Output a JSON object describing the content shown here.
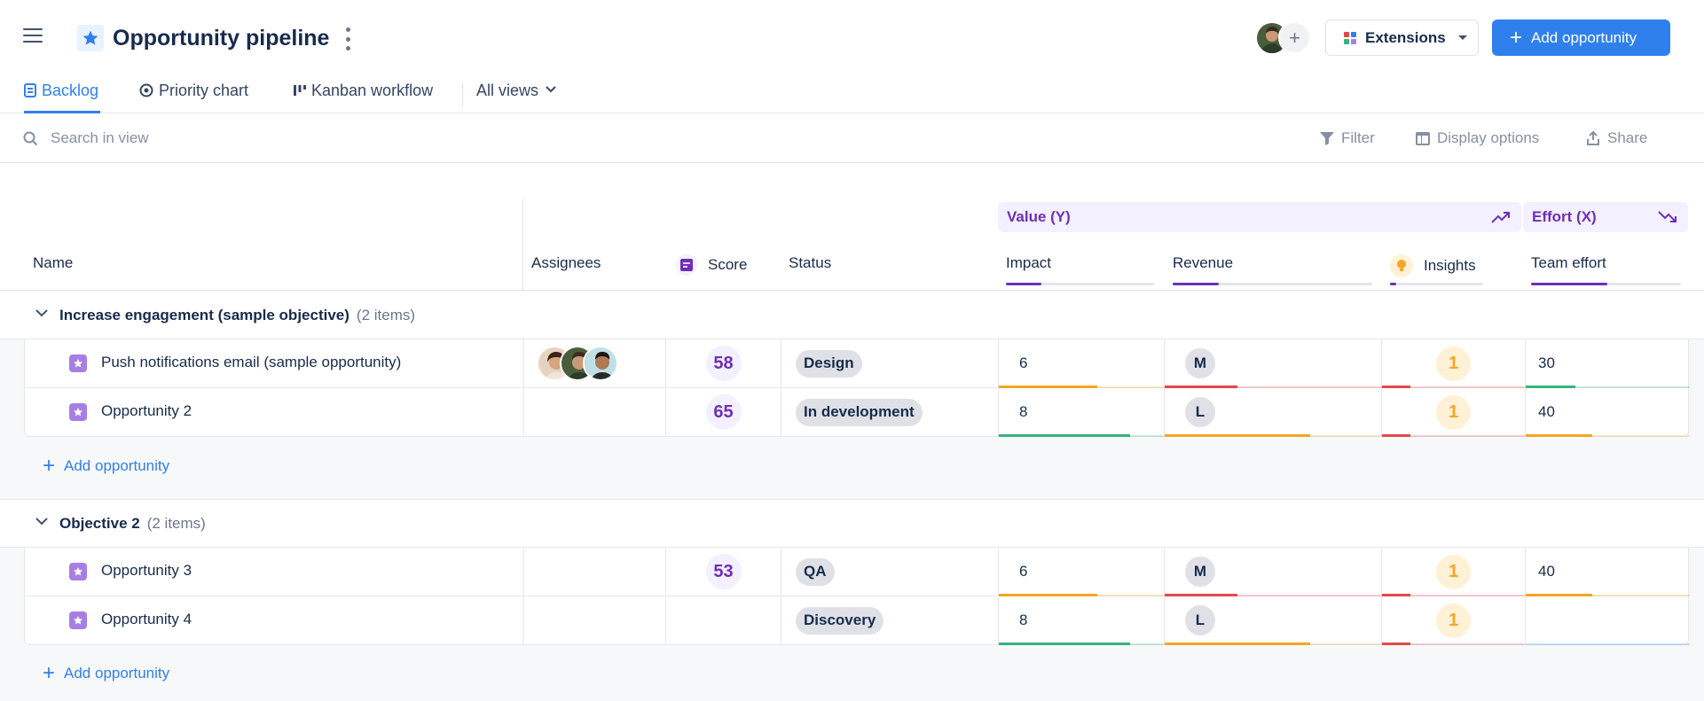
{
  "header": {
    "title": "Opportunity pipeline",
    "extensions_label": "Extensions",
    "add_button_label": "Add opportunity"
  },
  "tabs": [
    {
      "label": "Backlog",
      "active": true
    },
    {
      "label": "Priority chart"
    },
    {
      "label": "Kanban workflow"
    },
    {
      "label": "All views"
    }
  ],
  "toolbar": {
    "search_placeholder": "Search in view",
    "filter_label": "Filter",
    "display_label": "Display options",
    "share_label": "Share"
  },
  "column_groups": {
    "value": "Value (Y)",
    "effort": "Effort (X)"
  },
  "columns": {
    "name": "Name",
    "assignees": "Assignees",
    "score": "Score",
    "status": "Status",
    "impact": "Impact",
    "revenue": "Revenue",
    "insights": "Insights",
    "team_effort": "Team effort"
  },
  "groups": [
    {
      "name": "Increase engagement (sample objective)",
      "count": "(2 items)",
      "add_label": "Add opportunity",
      "rows": [
        {
          "name": "Push notifications email (sample opportunity)",
          "score": "58",
          "status": "Design",
          "impact": "6",
          "revenue": "M",
          "insights": "1",
          "effort": "30"
        },
        {
          "name": "Opportunity 2",
          "score": "65",
          "status": "In development",
          "impact": "8",
          "revenue": "L",
          "insights": "1",
          "effort": "40"
        }
      ]
    },
    {
      "name": "Objective 2",
      "count": "(2 items)",
      "add_label": "Add opportunity",
      "rows": [
        {
          "name": "Opportunity 3",
          "score": "53",
          "status": "QA",
          "impact": "6",
          "revenue": "M",
          "insights": "1",
          "effort": "40"
        },
        {
          "name": "Opportunity 4",
          "score": "",
          "status": "Discovery",
          "impact": "8",
          "revenue": "L",
          "insights": "1",
          "effort": ""
        }
      ]
    }
  ],
  "colors": {
    "accent": "#2f80ed",
    "purple": "#6e2fb5",
    "orange": "#f5a623",
    "green": "#36b37e",
    "red": "#e5484d"
  }
}
